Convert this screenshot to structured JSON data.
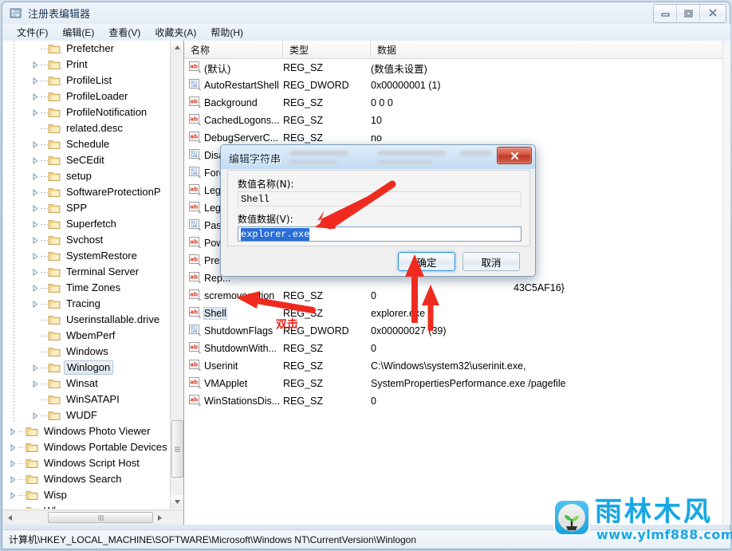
{
  "window": {
    "title": "注册表编辑器",
    "icon": "registry-icon",
    "controls": {
      "minimize": "minimize-icon",
      "maximize": "maximize-icon",
      "close": "close-icon"
    }
  },
  "menubar": {
    "items": [
      {
        "label": "文件(F)",
        "name": "menu-file"
      },
      {
        "label": "编辑(E)",
        "name": "menu-edit"
      },
      {
        "label": "查看(V)",
        "name": "menu-view"
      },
      {
        "label": "收藏夹(A)",
        "name": "menu-favorites"
      },
      {
        "label": "帮助(H)",
        "name": "menu-help"
      }
    ]
  },
  "tree": {
    "items": [
      {
        "label": "Prefetcher",
        "indent": 1,
        "expandable": false,
        "selected": false
      },
      {
        "label": "Print",
        "indent": 1,
        "expandable": true,
        "selected": false
      },
      {
        "label": "ProfileList",
        "indent": 1,
        "expandable": true,
        "selected": false
      },
      {
        "label": "ProfileLoader",
        "indent": 1,
        "expandable": true,
        "selected": false
      },
      {
        "label": "ProfileNotification",
        "indent": 1,
        "expandable": true,
        "selected": false
      },
      {
        "label": "related.desc",
        "indent": 1,
        "expandable": false,
        "selected": false
      },
      {
        "label": "Schedule",
        "indent": 1,
        "expandable": true,
        "selected": false
      },
      {
        "label": "SeCEdit",
        "indent": 1,
        "expandable": true,
        "selected": false
      },
      {
        "label": "setup",
        "indent": 1,
        "expandable": true,
        "selected": false
      },
      {
        "label": "SoftwareProtectionP",
        "indent": 1,
        "expandable": true,
        "selected": false
      },
      {
        "label": "SPP",
        "indent": 1,
        "expandable": true,
        "selected": false
      },
      {
        "label": "Superfetch",
        "indent": 1,
        "expandable": true,
        "selected": false
      },
      {
        "label": "Svchost",
        "indent": 1,
        "expandable": true,
        "selected": false
      },
      {
        "label": "SystemRestore",
        "indent": 1,
        "expandable": true,
        "selected": false
      },
      {
        "label": "Terminal Server",
        "indent": 1,
        "expandable": true,
        "selected": false
      },
      {
        "label": "Time Zones",
        "indent": 1,
        "expandable": true,
        "selected": false
      },
      {
        "label": "Tracing",
        "indent": 1,
        "expandable": true,
        "selected": false
      },
      {
        "label": "Userinstallable.drive",
        "indent": 1,
        "expandable": false,
        "selected": false
      },
      {
        "label": "WbemPerf",
        "indent": 1,
        "expandable": false,
        "selected": false
      },
      {
        "label": "Windows",
        "indent": 1,
        "expandable": false,
        "selected": false
      },
      {
        "label": "Winlogon",
        "indent": 1,
        "expandable": true,
        "selected": true
      },
      {
        "label": "Winsat",
        "indent": 1,
        "expandable": true,
        "selected": false
      },
      {
        "label": "WinSATAPI",
        "indent": 1,
        "expandable": false,
        "selected": false
      },
      {
        "label": "WUDF",
        "indent": 1,
        "expandable": true,
        "selected": false
      },
      {
        "label": "Windows Photo Viewer",
        "indent": 0,
        "expandable": true,
        "selected": false
      },
      {
        "label": "Windows Portable Devices",
        "indent": 0,
        "expandable": true,
        "selected": false
      },
      {
        "label": "Windows Script Host",
        "indent": 0,
        "expandable": true,
        "selected": false
      },
      {
        "label": "Windows Search",
        "indent": 0,
        "expandable": true,
        "selected": false
      },
      {
        "label": "Wisp",
        "indent": 0,
        "expandable": true,
        "selected": false
      },
      {
        "label": "Wlansvc",
        "indent": 0,
        "expandable": true,
        "selected": false
      }
    ]
  },
  "list": {
    "columns": [
      {
        "label": "名称",
        "name": "column-name"
      },
      {
        "label": "类型",
        "name": "column-type"
      },
      {
        "label": "数据",
        "name": "column-data"
      }
    ],
    "rows": [
      {
        "name": "(默认)",
        "type": "REG_SZ",
        "data": "(数值未设置)",
        "icon": "string-value-icon"
      },
      {
        "name": "AutoRestartShell",
        "type": "REG_DWORD",
        "data": "0x00000001 (1)",
        "icon": "dword-value-icon"
      },
      {
        "name": "Background",
        "type": "REG_SZ",
        "data": "0 0 0",
        "icon": "string-value-icon"
      },
      {
        "name": "CachedLogons...",
        "type": "REG_SZ",
        "data": "10",
        "icon": "string-value-icon"
      },
      {
        "name": "DebugServerC...",
        "type": "REG_SZ",
        "data": "no",
        "icon": "string-value-icon"
      },
      {
        "name": "Disa...",
        "type": "",
        "data": "",
        "icon": "dword-value-icon"
      },
      {
        "name": "Forc...",
        "type": "",
        "data": "",
        "icon": "dword-value-icon"
      },
      {
        "name": "Lega...",
        "type": "",
        "data": "",
        "icon": "string-value-icon"
      },
      {
        "name": "Lega...",
        "type": "",
        "data": "",
        "icon": "string-value-icon"
      },
      {
        "name": "Pass...",
        "type": "",
        "data": "",
        "icon": "dword-value-icon"
      },
      {
        "name": "Pow...",
        "type": "",
        "data": "",
        "icon": "string-value-icon"
      },
      {
        "name": "PreC...",
        "type": "",
        "data": "",
        "icon": "string-value-icon"
      },
      {
        "name": "Rep...",
        "type": "",
        "data": "",
        "icon": "string-value-icon"
      },
      {
        "name": "scremoveoption",
        "type": "REG_SZ",
        "data": "0",
        "icon": "string-value-icon"
      },
      {
        "name": "Shell",
        "type": "REG_SZ",
        "data": "explorer.exe",
        "icon": "string-value-icon",
        "selected": true
      },
      {
        "name": "ShutdownFlags",
        "type": "REG_DWORD",
        "data": "0x00000027 (39)",
        "icon": "dword-value-icon"
      },
      {
        "name": "ShutdownWith...",
        "type": "REG_SZ",
        "data": "0",
        "icon": "string-value-icon"
      },
      {
        "name": "Userinit",
        "type": "REG_SZ",
        "data": "C:\\Windows\\system32\\userinit.exe,",
        "icon": "string-value-icon"
      },
      {
        "name": "VMApplet",
        "type": "REG_SZ",
        "data": "SystemPropertiesPerformance.exe /pagefile",
        "icon": "string-value-icon"
      },
      {
        "name": "WinStationsDis...",
        "type": "REG_SZ",
        "data": "0",
        "icon": "string-value-icon"
      }
    ],
    "partial_guid": "43C5AF16}"
  },
  "dialog": {
    "title": "编辑字符串",
    "name_label": "数值名称(N):",
    "name_value": "Shell",
    "data_label": "数值数据(V):",
    "data_value": "explorer.exe",
    "ok_label": "确定",
    "cancel_label": "取消",
    "close_icon": "close-icon"
  },
  "annotations": {
    "double_click_text": "双击"
  },
  "statusbar": {
    "path": "计算机\\HKEY_LOCAL_MACHINE\\SOFTWARE\\Microsoft\\Windows NT\\CurrentVersion\\Winlogon"
  },
  "watermark": {
    "brand": "雨林木风",
    "url": "www.ylmf888.com"
  },
  "colors": {
    "accent_blue": "#17a6e3",
    "annotation_red": "#e8231a",
    "selection_blue": "#2a6fd6",
    "title_text": "#10305a"
  }
}
